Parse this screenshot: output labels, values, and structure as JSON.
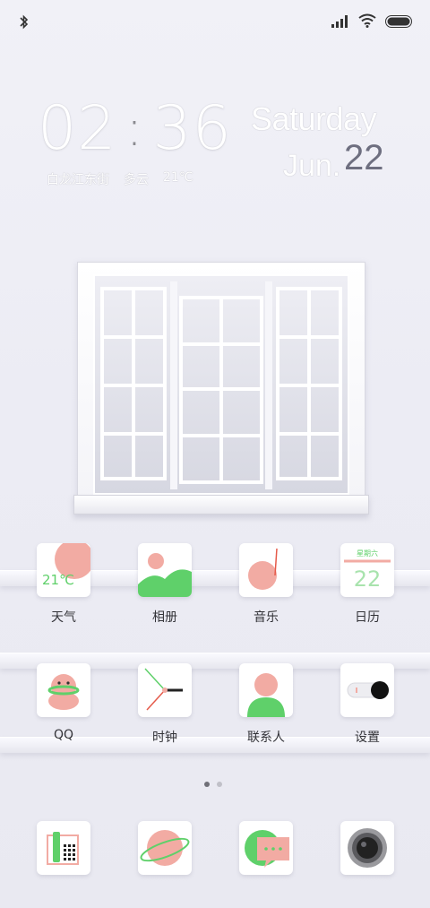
{
  "status_bar": {
    "bluetooth_icon": "bluetooth-icon",
    "signal_icon": "signal-icon",
    "wifi_icon": "wifi-icon",
    "battery_icon": "battery-icon"
  },
  "clock": {
    "hours": "02",
    "minutes": "36",
    "location": "白龙江东街",
    "weather": "多云",
    "temperature": "21℃"
  },
  "date": {
    "weekday": "Saturday",
    "month": "Jun.",
    "day": "22"
  },
  "apps_row1": [
    {
      "label": "天气",
      "icon": "weather-icon",
      "icon_text": "21℃"
    },
    {
      "label": "相册",
      "icon": "gallery-icon"
    },
    {
      "label": "音乐",
      "icon": "music-icon"
    },
    {
      "label": "日历",
      "icon": "calendar-icon",
      "icon_header": "星期六",
      "icon_day": "22"
    }
  ],
  "apps_row2": [
    {
      "label": "QQ",
      "icon": "qq-icon"
    },
    {
      "label": "时钟",
      "icon": "clock-icon"
    },
    {
      "label": "联系人",
      "icon": "contacts-icon"
    },
    {
      "label": "设置",
      "icon": "settings-icon"
    }
  ],
  "page_indicator": {
    "count": 2,
    "active": 0
  },
  "dock": [
    {
      "icon": "phone-icon"
    },
    {
      "icon": "browser-icon"
    },
    {
      "icon": "messages-icon"
    },
    {
      "icon": "camera-icon"
    }
  ],
  "colors": {
    "pink": "#f2aba3",
    "green": "#5fd06a",
    "red": "#e55a4a"
  }
}
